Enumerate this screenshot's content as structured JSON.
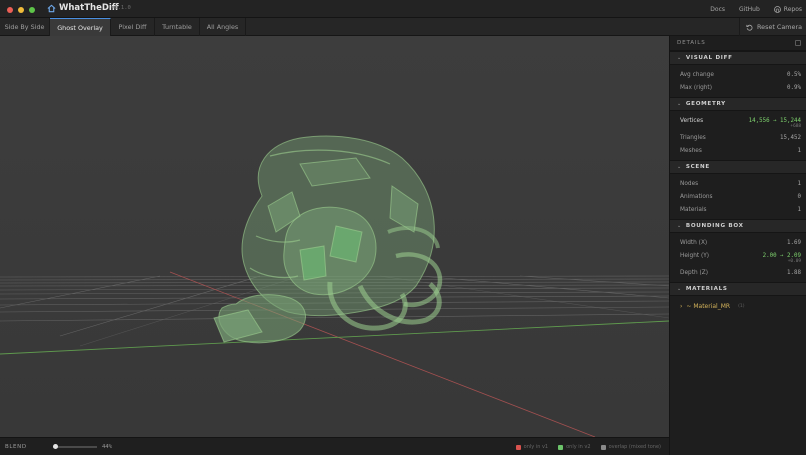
{
  "app": {
    "title": "WhatTheDiff",
    "version": "v0.1.0"
  },
  "top_links": [
    {
      "label": "Docs"
    },
    {
      "label": "GitHub"
    },
    {
      "label": "Repos",
      "icon": "github-icon"
    }
  ],
  "tabs": [
    {
      "label": "Side By Side",
      "active": false
    },
    {
      "label": "Ghost Overlay",
      "active": true
    },
    {
      "label": "Pixel Diff",
      "active": false
    },
    {
      "label": "Turntable",
      "active": false
    },
    {
      "label": "All Angles",
      "active": false
    }
  ],
  "reset_camera": {
    "label": "Reset Camera",
    "icon": "reset-icon"
  },
  "bottom": {
    "blend_label": "BLEND",
    "blend_value": "44%",
    "blend_fraction": 0.44,
    "legend": [
      {
        "label": "only in v1",
        "color": "#d9534f"
      },
      {
        "label": "only in v2",
        "color": "#6cc46a"
      },
      {
        "label": "overlap (mixed tone)",
        "color": "#8a8a8a"
      }
    ]
  },
  "sidebar": {
    "title": "DETAILS",
    "visual_diff": {
      "title": "VISUAL DIFF",
      "rows": [
        {
          "label": "Avg change",
          "value": "0.5%"
        },
        {
          "label": "Max (right)",
          "value": "0.9%"
        }
      ]
    },
    "geometry": {
      "title": "GEOMETRY",
      "vertices_label": "Vertices",
      "vertices_value": "14,556 → 15,244",
      "vertices_delta": "+688",
      "triangles_label": "Triangles",
      "triangles_value": "15,452",
      "meshes_label": "Meshes",
      "meshes_value": "1"
    },
    "scene": {
      "title": "SCENE",
      "rows": [
        {
          "label": "Nodes",
          "value": "1"
        },
        {
          "label": "Animations",
          "value": "0"
        },
        {
          "label": "Materials",
          "value": "1"
        }
      ]
    },
    "bounding_box": {
      "title": "BOUNDING BOX",
      "width_label": "Width (X)",
      "width_value": "1.69",
      "height_label": "Height (Y)",
      "height_value": "2.00 → 2.09",
      "height_delta": "+0.09",
      "depth_label": "Depth (Z)",
      "depth_value": "1.88"
    },
    "materials": {
      "title": "MATERIALS",
      "item_name": "~ Material_MR",
      "item_count": "(1)"
    }
  },
  "colors": {
    "accent": "#4a8fe0",
    "added": "#7fd36e",
    "material": "#d4b35a",
    "viewport_bg": "#3b3b3b"
  }
}
